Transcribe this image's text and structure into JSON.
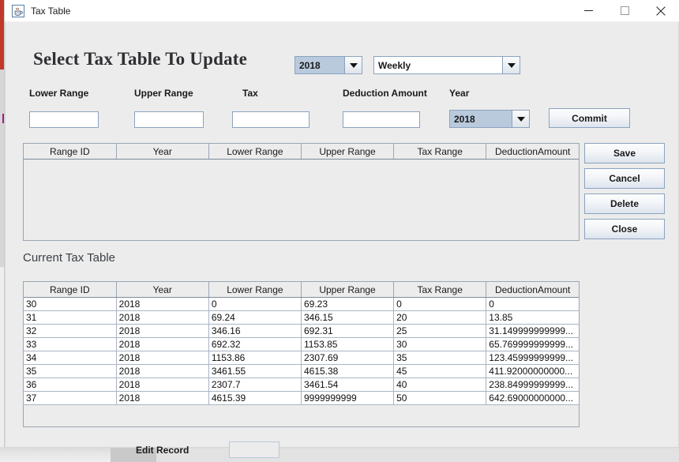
{
  "window": {
    "title": "Tax Table",
    "icon": "java-coffee-cup-icon",
    "minimize": "—",
    "maximize": "□",
    "close": "✕"
  },
  "heading": "Select Tax Table To Update",
  "top_selectors": {
    "year": {
      "value": "2018",
      "arrow": "chevron-down-icon"
    },
    "period": {
      "value": "Weekly",
      "arrow": "chevron-down-icon"
    }
  },
  "form": {
    "labels": {
      "lower_range": "Lower Range",
      "upper_range": "Upper Range",
      "tax": "Tax",
      "deduction_amount": "Deduction Amount",
      "year": "Year"
    },
    "values": {
      "lower_range": "",
      "upper_range": "",
      "tax": "",
      "deduction_amount": "",
      "year": "2018"
    },
    "commit_label": "Commit"
  },
  "side_buttons": {
    "save": "Save",
    "cancel": "Cancel",
    "delete": "Delete",
    "close": "Close"
  },
  "edit_table": {
    "columns": [
      "Range ID",
      "Year",
      "Lower Range",
      "Upper Range",
      "Tax Range",
      "DeductionAmount"
    ],
    "rows": []
  },
  "current_table": {
    "caption": "Current Tax Table",
    "columns": [
      "Range ID",
      "Year",
      "Lower Range",
      "Upper Range",
      "Tax Range",
      "DeductionAmount"
    ],
    "rows": [
      [
        "30",
        "2018",
        "0",
        "69.23",
        "0",
        "0"
      ],
      [
        "31",
        "2018",
        "69.24",
        "346.15",
        "20",
        "13.85"
      ],
      [
        "32",
        "2018",
        "346.16",
        "692.31",
        "25",
        "31.149999999999..."
      ],
      [
        "33",
        "2018",
        "692.32",
        "1153.85",
        "30",
        "65.769999999999..."
      ],
      [
        "34",
        "2018",
        "1153.86",
        "2307.69",
        "35",
        "123.45999999999..."
      ],
      [
        "35",
        "2018",
        "3461.55",
        "4615.38",
        "45",
        "411.92000000000..."
      ],
      [
        "36",
        "2018",
        "2307.7",
        "3461.54",
        "40",
        "238.84999999999..."
      ],
      [
        "37",
        "2018",
        "4615.39",
        "9999999999",
        "50",
        "642.69000000000..."
      ]
    ]
  },
  "edit_record": {
    "label": "Edit Record",
    "value": ""
  },
  "colors": {
    "window_bg": "#ececec",
    "combo_selected_bg": "#b9cadd",
    "border_blue": "#8ba3bf",
    "grid_border": "#9aa6b4",
    "accent_red": "#c0392b"
  }
}
